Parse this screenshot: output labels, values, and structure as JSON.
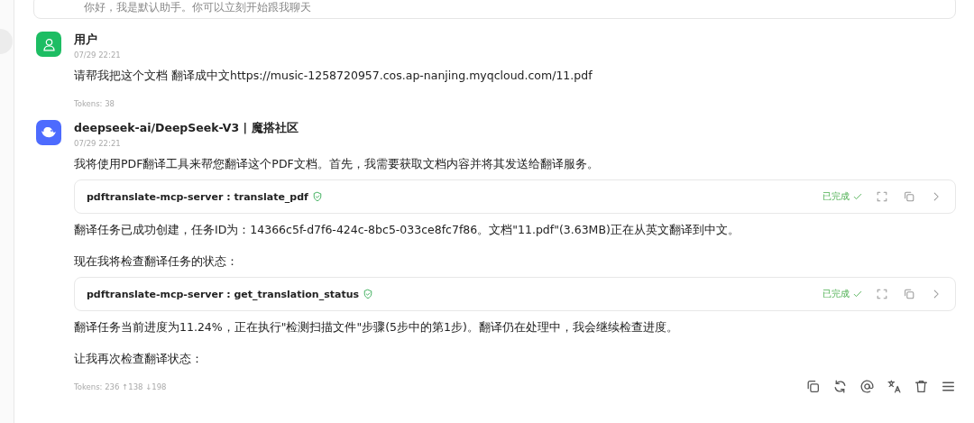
{
  "greeting": "你好，我是默认助手。你可以立刻开始跟我聊天",
  "messages": [
    {
      "kind": "user",
      "name": "用户",
      "time": "07/29 22:21",
      "blocks": [
        {
          "kind": "text",
          "text": "请帮我把这个文档 翻译成中文https://music-1258720957.cos.ap-nanjing.myqcloud.com/11.pdf"
        }
      ],
      "tokens": "Tokens: 38"
    },
    {
      "kind": "assistant",
      "name": "deepseek-ai/DeepSeek-V3 | 魔搭社区",
      "time": "07/29 22:21",
      "blocks": [
        {
          "kind": "text",
          "text": "我将使用PDF翻译工具来帮您翻译这个PDF文档。首先，我需要获取文档内容并将其发送给翻译服务。"
        },
        {
          "kind": "tool",
          "text": "pdftranslate-mcp-server : translate_pdf",
          "status": "已完成"
        },
        {
          "kind": "text",
          "text": "翻译任务已成功创建，任务ID为：14366c5f-d7f6-424c-8bc5-033ce8fc7f86。文档\"11.pdf\"(3.63MB)正在从英文翻译到中文。"
        },
        {
          "kind": "text",
          "text": "现在我将检查翻译任务的状态："
        },
        {
          "kind": "tool",
          "text": "pdftranslate-mcp-server : get_translation_status",
          "status": "已完成"
        },
        {
          "kind": "text",
          "text": "翻译任务当前进度为11.24%，正在执行\"检测扫描文件\"步骤(5步中的第1步)。翻译仍在处理中，我会继续检查进度。"
        },
        {
          "kind": "text",
          "text": "让我再次检查翻译状态："
        }
      ],
      "tokens": "Tokens: 236 ↑138 ↓198"
    }
  ]
}
